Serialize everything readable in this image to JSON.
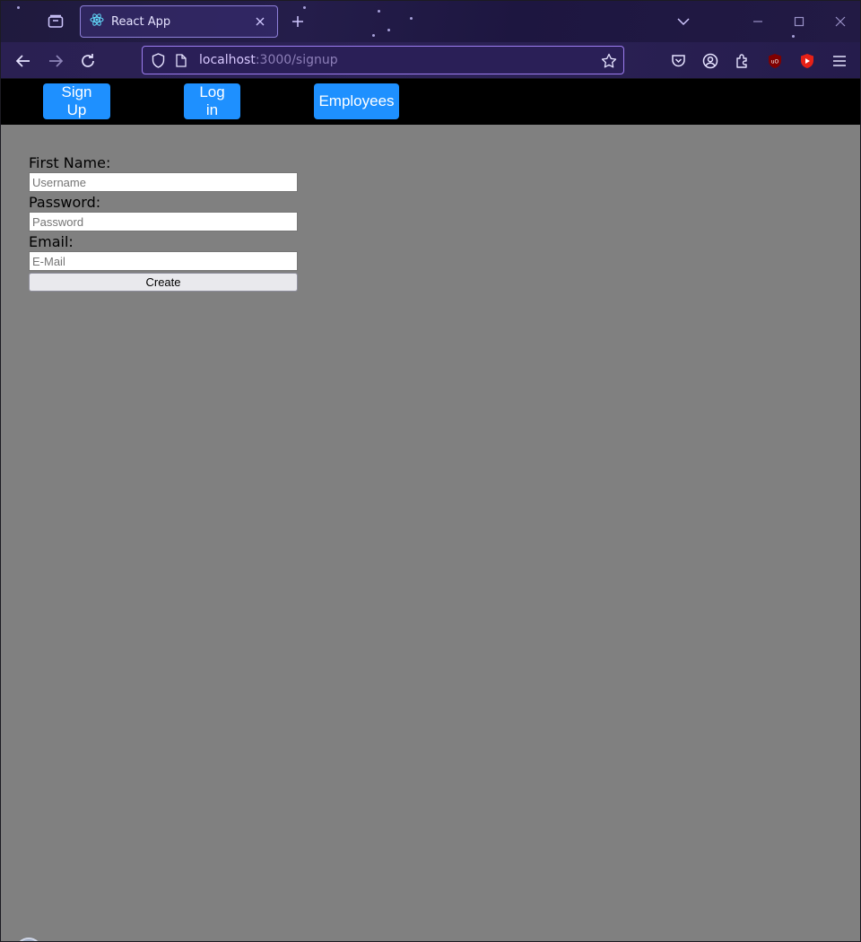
{
  "browser": {
    "tab": {
      "title": "React App"
    },
    "url": {
      "host": "localhost",
      "path": ":3000/signup"
    }
  },
  "nav": {
    "signup_label": "Sign Up",
    "login_label": "Log in",
    "employees_label": "Employees"
  },
  "form": {
    "first_name_label": "First Name:",
    "username_placeholder": "Username",
    "password_label": "Password:",
    "password_placeholder": "Password",
    "email_label": "Email:",
    "email_placeholder": "E-Mail",
    "submit_label": "Create"
  },
  "colors": {
    "page_bg": "#808080",
    "header_bg": "#000000",
    "nav_button": "#1e90ff",
    "browser_chrome": "#241d4a"
  }
}
